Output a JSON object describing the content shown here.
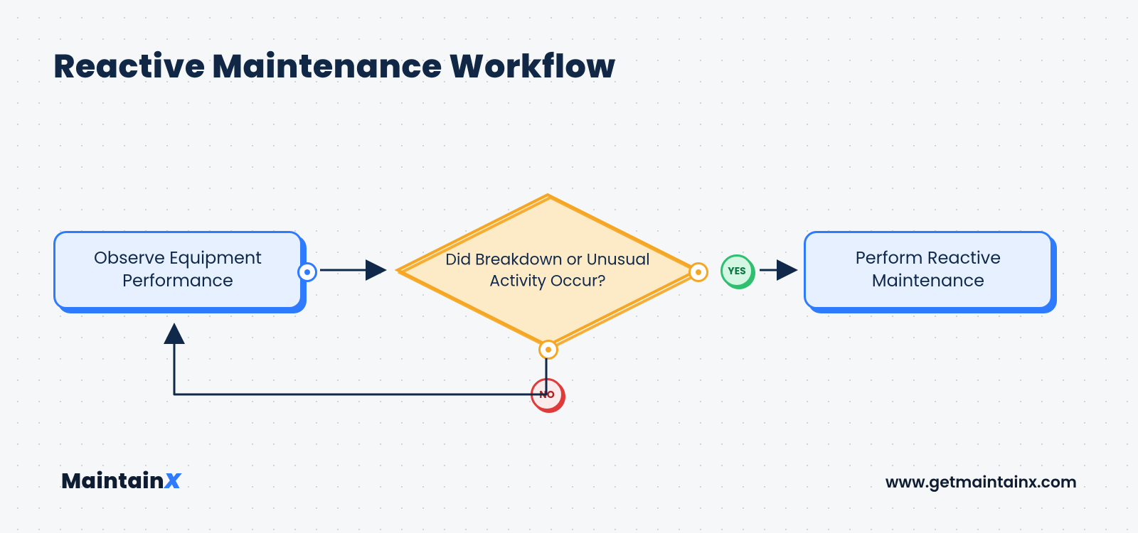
{
  "title": "Reactive Maintenance Workflow",
  "nodes": {
    "observe": "Observe Equipment Performance",
    "decision": "Did Breakdown or Unusual Activity Occur?",
    "perform": "Perform Reactive Maintenance"
  },
  "edges": {
    "yes": "YES",
    "no": "NO"
  },
  "footer": {
    "brand_prefix": "Maintain",
    "brand_suffix": "X",
    "url": "www.getmaintainx.com"
  },
  "colors": {
    "title": "#102845",
    "process_border": "#2f7bff",
    "process_fill": "#e6f0ff",
    "decision_border": "#f5a623",
    "decision_fill": "#fdebc8",
    "yes_border": "#2fbf71",
    "no_border": "#e03b3b",
    "arrow": "#10294a"
  }
}
